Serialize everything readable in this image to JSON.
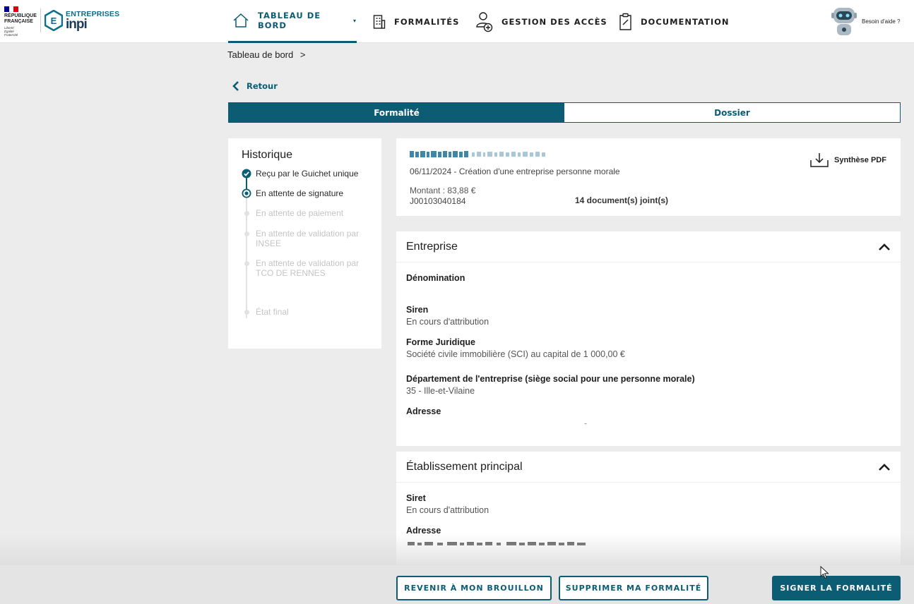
{
  "header": {
    "gov_logo": {
      "line1": "RÉPUBLIQUE",
      "line2": "FRANÇAISE",
      "motto": [
        "Liberté",
        "Égalité",
        "Fraternité"
      ],
      "flag_colors": [
        "#000091",
        "#ffffff",
        "#e1000f"
      ]
    },
    "brand": {
      "top": "ENTREPRISES",
      "name": "inpi",
      "badge_letter": "E"
    },
    "nav": [
      {
        "label": "TABLEAU DE BORD",
        "icon": "home-icon",
        "active": true,
        "caret": "▾"
      },
      {
        "label": "FORMALITÉS",
        "icon": "building-icon",
        "active": false
      },
      {
        "label": "GESTION DES ACCÈS",
        "icon": "user-add-icon",
        "active": false
      },
      {
        "label": "DOCUMENTATION",
        "icon": "document-icon",
        "active": false
      }
    ],
    "help_label": "Besoin d'aide ?"
  },
  "breadcrumb": {
    "item": "Tableau de bord",
    "separator": ">"
  },
  "back_label": "Retour",
  "tabs": [
    {
      "label": "Formalité",
      "active": true
    },
    {
      "label": "Dossier",
      "active": false
    }
  ],
  "history": {
    "title": "Historique",
    "steps": [
      {
        "label": "Reçu par le Guichet unique",
        "status": "done"
      },
      {
        "label": "En attente de signature",
        "status": "current"
      },
      {
        "label": "En attente de paiement",
        "status": "pending"
      },
      {
        "label": "En attente de validation par INSEE",
        "status": "pending"
      },
      {
        "label": "En attente de validation par TCO DE RENNES",
        "status": "pending"
      },
      {
        "label": "État final",
        "status": "pending"
      }
    ]
  },
  "summary": {
    "date_line": "06/11/2024 - Création d'une entreprise personne morale",
    "amount": "Montant : 83,88 €",
    "reference": "J00103040184",
    "documents": "14 document(s) joint(s)",
    "pdf_label": "Synthèse PDF"
  },
  "entreprise": {
    "title": "Entreprise",
    "fields": [
      {
        "label": "Dénomination",
        "value": ""
      },
      {
        "label": "Siren",
        "value": "En cours d'attribution"
      },
      {
        "label": "Forme Juridique",
        "value": "Société civile immobilière (SCI) au capital de 1 000,00 €"
      },
      {
        "label": "Département de l'entreprise (siège social pour une personne morale)",
        "value": "35 - Ille-et-Vilaine"
      },
      {
        "label": "Adresse",
        "value": "-"
      }
    ]
  },
  "etablissement": {
    "title": "Établissement principal",
    "fields": [
      {
        "label": "Siret",
        "value": "En cours d'attribution"
      },
      {
        "label": "Adresse",
        "value": ""
      }
    ]
  },
  "actions": {
    "back_draft": "REVENIR À MON BROUILLON",
    "delete": "SUPPRIMER MA FORMALITÉ",
    "sign": "SIGNER LA FORMALITÉ"
  },
  "colors": {
    "primary": "#0c5c74",
    "background": "#ececec",
    "pending": "#c4c4c4"
  }
}
